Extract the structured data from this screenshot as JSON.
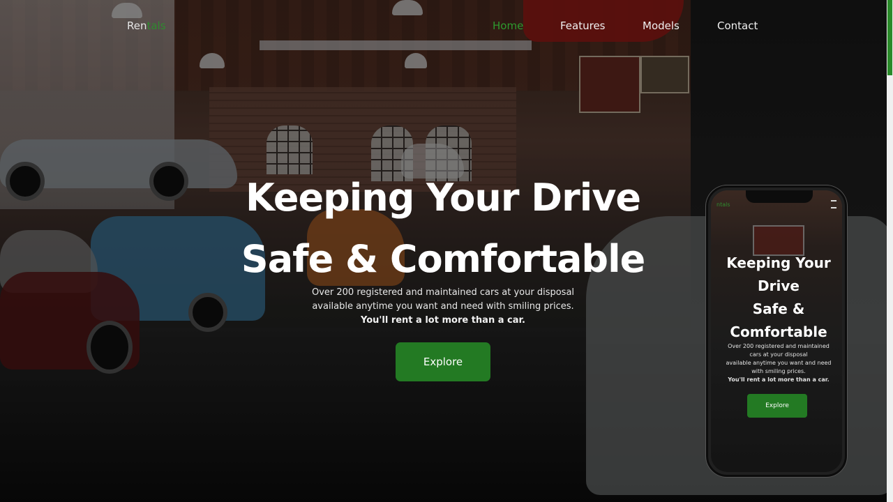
{
  "brand": {
    "part1": "Ren",
    "part2": "tals"
  },
  "nav": {
    "items": [
      {
        "label": "Home",
        "active": true
      },
      {
        "label": "Features",
        "active": false
      },
      {
        "label": "Models",
        "active": false
      },
      {
        "label": "Contact",
        "active": false
      }
    ]
  },
  "hero": {
    "title_line1": "Keeping Your Drive",
    "title_line2": "Safe & Comfortable",
    "subtitle_line1": "Over 200 registered and maintained cars at your disposal",
    "subtitle_line2": "available anytime you want and need with smiling prices.",
    "subtitle_bold": "You'll rent a lot more than a car.",
    "cta_label": "Explore"
  },
  "phone": {
    "brand": "ntals",
    "title_line1": "Keeping Your",
    "title_line2": "Drive",
    "title_line3": "Safe &",
    "title_line4": "Comfortable",
    "subtitle_line1": "Over 200 registered and maintained",
    "subtitle_line2": "cars at your disposal",
    "subtitle_line3": "available anytime you want and need",
    "subtitle_line4": "with smiling prices.",
    "subtitle_bold": "You'll rent a lot more than a car.",
    "cta_label": "Explore"
  },
  "colors": {
    "accent_green": "#237a23",
    "active_nav": "#2e9a2e",
    "overlay": "rgba(0,0,0,0.42)"
  },
  "icons": {
    "phone_menu": "hamburger-menu-icon"
  }
}
